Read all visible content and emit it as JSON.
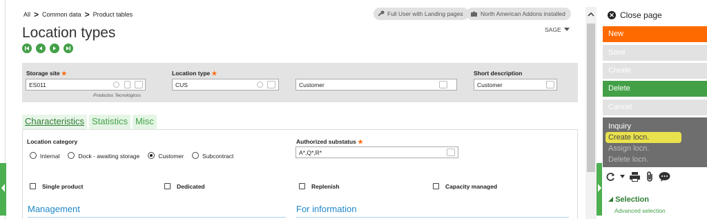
{
  "breadcrumb": {
    "items": [
      "All",
      "Common data",
      "Product tables"
    ],
    "sep": ">"
  },
  "badges": {
    "user": "Full User with Landing pages",
    "addons": "North American Addons installed"
  },
  "page": {
    "title": "Location types",
    "company": "SAGE"
  },
  "header": {
    "storage_site": {
      "label": "Storage site",
      "value": "ES011",
      "subtext": "Productos Tecnológicos"
    },
    "location_type": {
      "label": "Location type",
      "value": "CUS",
      "description": "Customer"
    },
    "short_description": {
      "label": "Short description",
      "value": "Customer"
    }
  },
  "tabs": [
    "Characteristics",
    "Statistics",
    "Misc"
  ],
  "characteristics": {
    "category_label": "Location category",
    "categories": [
      "Internal",
      "Dock - awaiting storage",
      "Customer",
      "Subcontract"
    ],
    "selected_category": "Customer",
    "substatus_label": "Authorized substatus",
    "substatus_value": "A*,Q*,R*",
    "checkboxes": [
      "Single product",
      "Dedicated",
      "Replenish",
      "Capacity managed"
    ],
    "section_management": "Management",
    "section_info": "For information"
  },
  "actions": {
    "close": "Close page",
    "new": "New",
    "save": "Save",
    "create": "Create",
    "delete": "Delete",
    "cancel": "Cancel",
    "inquiry": "Inquiry",
    "create_locn": "Create locn.",
    "assign_locn": "Assign locn.",
    "delete_locn": "Delete locn.",
    "selection": "Selection",
    "advanced_selection": "Advanced selection"
  },
  "colors": {
    "accent_green": "#43a047",
    "new_orange": "#ff6a00",
    "highlight": "#e9e24c",
    "link_blue": "#1e88c8"
  }
}
